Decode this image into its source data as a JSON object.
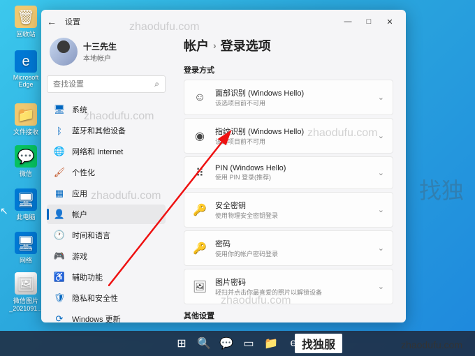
{
  "desktop": {
    "icons": [
      {
        "label": "回收站",
        "glyph": "🗑"
      },
      {
        "label": "Microsoft Edge",
        "glyph": "e"
      },
      {
        "label": "文件接收",
        "glyph": "📁"
      },
      {
        "label": "微信",
        "glyph": "💬"
      },
      {
        "label": "此电脑",
        "glyph": "🖥"
      },
      {
        "label": "网络",
        "glyph": "🖥"
      },
      {
        "label": "微信图片_2021091...",
        "glyph": "🖼"
      }
    ]
  },
  "window": {
    "title": "设置",
    "min": "—",
    "max": "□",
    "close": "✕"
  },
  "profile": {
    "name": "十三先生",
    "sub": "本地帐户"
  },
  "search": {
    "placeholder": "查找设置"
  },
  "nav": [
    {
      "icon": "🖥",
      "color": "#0067c0",
      "label": "系统"
    },
    {
      "icon": "ᛒ",
      "color": "#0067c0",
      "label": "蓝牙和其他设备"
    },
    {
      "icon": "🌐",
      "color": "#555",
      "label": "网络和 Internet"
    },
    {
      "icon": "🖌",
      "color": "#c05020",
      "label": "个性化"
    },
    {
      "icon": "▦",
      "color": "#0067c0",
      "label": "应用"
    },
    {
      "icon": "👤",
      "color": "#555",
      "label": "帐户"
    },
    {
      "icon": "🕐",
      "color": "#c05020",
      "label": "时间和语言"
    },
    {
      "icon": "🎮",
      "color": "#0067c0",
      "label": "游戏"
    },
    {
      "icon": "♿",
      "color": "#0067c0",
      "label": "辅助功能"
    },
    {
      "icon": "🛡",
      "color": "#0067c0",
      "label": "隐私和安全性"
    },
    {
      "icon": "⟳",
      "color": "#0067c0",
      "label": "Windows 更新"
    }
  ],
  "breadcrumb": {
    "part1": "帐户",
    "sep": "›",
    "part2": "登录选项"
  },
  "sections": {
    "signinMethods": "登录方式",
    "other": "其他设置"
  },
  "options": [
    {
      "icon": "☺",
      "title": "面部识别 (Windows Hello)",
      "sub": "该选项目前不可用"
    },
    {
      "icon": "◉",
      "title": "指纹识别 (Windows Hello)",
      "sub": "该选项目前不可用"
    },
    {
      "icon": "⠿",
      "title": "PIN (Windows Hello)",
      "sub": "使用 PIN 登录(推荐)"
    },
    {
      "icon": "🔑",
      "title": "安全密钥",
      "sub": "使用物理安全密钥登录"
    },
    {
      "icon": "🔑",
      "title": "密码",
      "sub": "使用你的帐户密码登录"
    },
    {
      "icon": "🖼",
      "title": "图片密码",
      "sub": "轻扫并点击你最喜爱的照片以解锁设备"
    }
  ],
  "chevron": "⌄",
  "taskbar": [
    "⊞",
    "🔍",
    "💬",
    "▭",
    "📁",
    "e"
  ],
  "watermark": "zhaodufu.com",
  "badge": "找独服",
  "wmBig": "找独"
}
